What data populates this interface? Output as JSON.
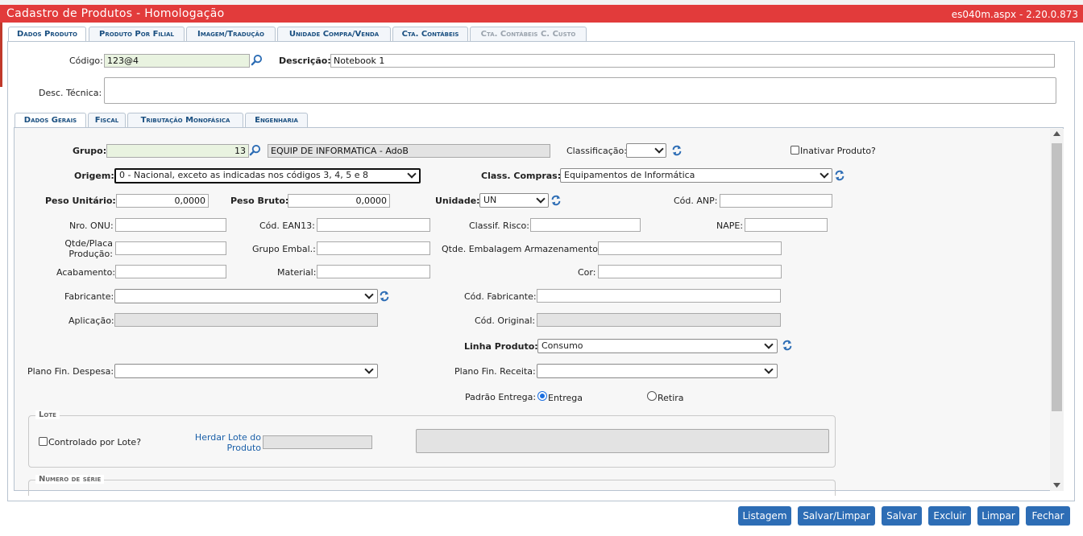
{
  "window": {
    "title": "Cadastro de Produtos - Homologação",
    "version": "es040m.aspx - 2.20.0.873"
  },
  "main_tabs": [
    {
      "label": "Dados Produto",
      "active": true
    },
    {
      "label": "Produto Por Filial"
    },
    {
      "label": "Imagem/Tradução"
    },
    {
      "label": "Unidade Compra/Venda"
    },
    {
      "label": "Cta. Contábeis"
    },
    {
      "label": "Cta. Contábeis C. Custo",
      "disabled": true
    }
  ],
  "header": {
    "codigo_label": "Código:",
    "codigo_value": "123@4",
    "descricao_label": "Descrição:",
    "descricao_value": "Notebook 1",
    "desc_tecnica_label": "Desc. Técnica:"
  },
  "sub_tabs": [
    {
      "label": "Dados Gerais",
      "active": true
    },
    {
      "label": "Fiscal"
    },
    {
      "label": "Tributação Monofásica"
    },
    {
      "label": "Engenharia"
    }
  ],
  "form": {
    "grupo_label": "Grupo:",
    "grupo_value": "13",
    "grupo_desc": "EQUIP DE INFORMATICA - AdoB",
    "classificacao_label": "Classificação:",
    "inativar_label": "Inativar Produto?",
    "origem_label": "Origem:",
    "origem_value": "0 - Nacional, exceto as indicadas nos códigos 3, 4, 5 e 8",
    "class_compras_label": "Class. Compras:",
    "class_compras_value": "Equipamentos de Informática",
    "peso_unitario_label": "Peso Unitário:",
    "peso_unitario_value": "0,0000",
    "peso_bruto_label": "Peso Bruto:",
    "peso_bruto_value": "0,0000",
    "unidade_label": "Unidade:",
    "unidade_value": "UN",
    "cod_anp_label": "Cód. ANP:",
    "nro_onu_label": "Nro. ONU:",
    "cod_ean13_label": "Cód. EAN13:",
    "classif_risco_label": "Classif. Risco:",
    "nape_label": "NAPE:",
    "qtde_placa_label_1": "Qtde/Placa",
    "qtde_placa_label_2": "Produção:",
    "grupo_embal_label": "Grupo Embal.:",
    "qtde_embalagem_label": "Qtde. Embalagem Armazenamento:",
    "acabamento_label": "Acabamento:",
    "material_label": "Material:",
    "cor_label": "Cor:",
    "fabricante_label": "Fabricante:",
    "cod_fabricante_label": "Cód. Fabricante:",
    "aplicacao_label": "Aplicação:",
    "cod_original_label": "Cód. Original:",
    "linha_produto_label": "Linha Produto:",
    "linha_produto_value": "Consumo",
    "plano_despesa_label": "Plano Fin. Despesa:",
    "plano_receita_label": "Plano Fin. Receita:",
    "padrao_entrega_label": "Padrão Entrega:",
    "entrega_label": "Entrega",
    "retira_label": "Retira"
  },
  "lote": {
    "legend": "Lote",
    "controlado_label": "Controlado por Lote?",
    "herdar_line1": "Herdar Lote do",
    "herdar_line2": "Produto"
  },
  "serie": {
    "legend": "Numero de série"
  },
  "buttons": {
    "listagem": "Listagem",
    "salvar_limpar": "Salvar/Limpar",
    "salvar": "Salvar",
    "excluir": "Excluir",
    "limpar": "Limpar",
    "fechar": "Fechar"
  },
  "colors": {
    "titlebar": "#e23b3b",
    "button": "#2d6db5",
    "tab_text": "#1a4f80"
  }
}
